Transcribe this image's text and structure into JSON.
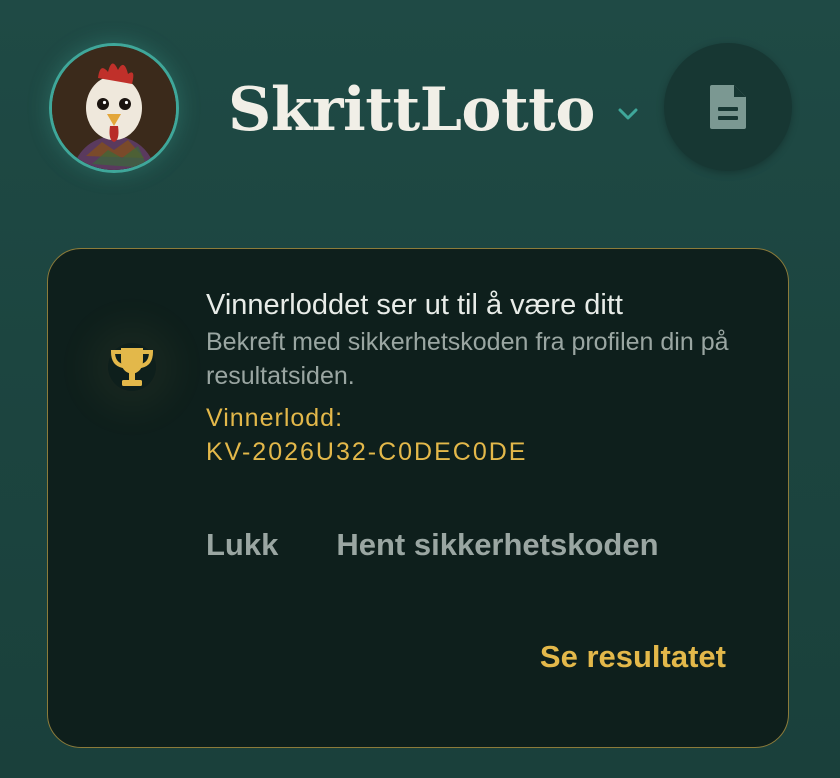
{
  "header": {
    "app_title": "SkrittLotto",
    "avatar_icon": "rooster-avatar-icon",
    "dropdown_icon": "chevron-down-icon",
    "doc_button_icon": "document-icon"
  },
  "notice": {
    "icon": "trophy-icon",
    "headline": "Vinnerloddet ser ut til å være ditt",
    "subtext": "Bekreft med sikkerhetskoden fra profilen din på resultatsiden.",
    "ticket_label": "Vinnerlodd:",
    "ticket_code": "KV-2026U32-C0DEC0DE",
    "close_label": "Lukk",
    "fetch_code_label": "Hent sikkerhetskoden",
    "see_result_label": "Se resultatet"
  },
  "colors": {
    "background": "#1d4641",
    "card_background": "#0e1f1c",
    "card_border": "#8c7b3a",
    "accent_gold": "#e3b84a",
    "accent_teal": "#3fa79a",
    "text_primary": "#e8ece8",
    "text_muted": "#9aa6a2"
  }
}
